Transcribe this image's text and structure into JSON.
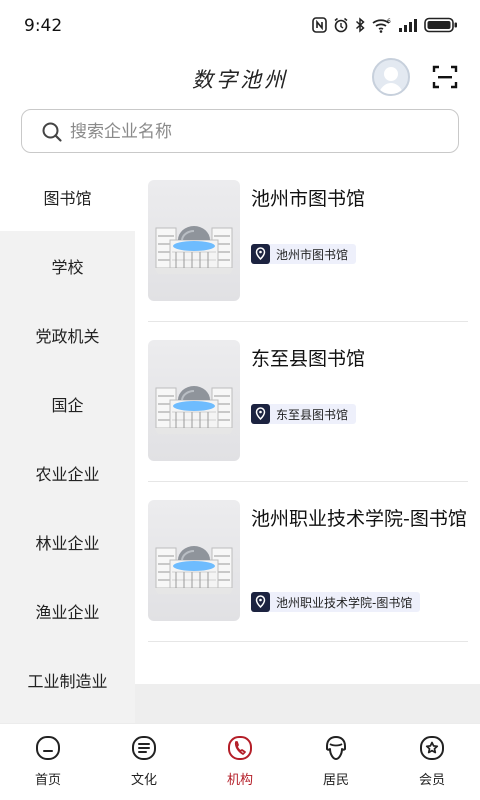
{
  "status_bar": {
    "time": "9:42",
    "icons": [
      "nfc-icon",
      "alarm-icon",
      "bluetooth-icon",
      "wifi-6-icon",
      "signal-icon",
      "battery-icon"
    ]
  },
  "header": {
    "title": "数字池州",
    "avatar_icon": "user-avatar-icon",
    "scan_icon": "scan-icon"
  },
  "search": {
    "placeholder": "搜索企业名称",
    "icon": "search-icon"
  },
  "sidebar": {
    "items": [
      {
        "label": "图书馆",
        "active": true
      },
      {
        "label": "学校",
        "active": false
      },
      {
        "label": "党政机关",
        "active": false
      },
      {
        "label": "国企",
        "active": false
      },
      {
        "label": "农业企业",
        "active": false
      },
      {
        "label": "林业企业",
        "active": false
      },
      {
        "label": "渔业企业",
        "active": false
      },
      {
        "label": "工业制造业",
        "active": false
      }
    ]
  },
  "list": {
    "items": [
      {
        "title": "池州市图书馆",
        "tag": "池州市图书馆",
        "tag_icon": "location-pin-icon"
      },
      {
        "title": "东至县图书馆",
        "tag": "东至县图书馆",
        "tag_icon": "location-pin-icon"
      },
      {
        "title": "池州职业技术学院-图书馆",
        "tag": "池州职业技术学院-图书馆",
        "tag_icon": "location-pin-icon"
      }
    ]
  },
  "tabbar": {
    "items": [
      {
        "label": "首页",
        "icon": "home-icon",
        "active": false
      },
      {
        "label": "文化",
        "icon": "culture-icon",
        "active": false
      },
      {
        "label": "机构",
        "icon": "institution-icon",
        "active": true
      },
      {
        "label": "居民",
        "icon": "residents-icon",
        "active": false
      },
      {
        "label": "会员",
        "icon": "member-icon",
        "active": false
      }
    ]
  },
  "colors": {
    "accent": "#b41e28",
    "sidebar_bg": "#f2f2f2",
    "tag_bg": "#eef0fb",
    "tag_icon_bg": "#1c2340",
    "glow": "#5fb6ff"
  }
}
